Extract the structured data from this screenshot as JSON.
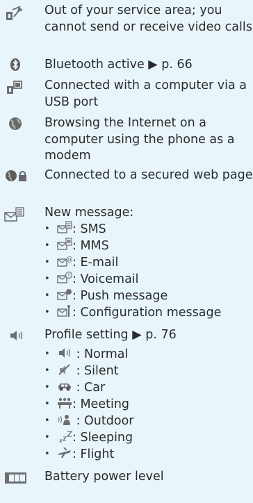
{
  "rows": [
    {
      "icon": "no-service-icon",
      "text": "Out of your service area; you cannot send or receive video calls"
    },
    {
      "icon": "bluetooth-icon",
      "text": "Bluetooth active ▶ p. 66"
    },
    {
      "icon": "usb-connection-icon",
      "text": "Connected with a computer via a USB port"
    },
    {
      "icon": "globe-icon",
      "text": "Browsing the Internet on a computer using the phone as a modem"
    },
    {
      "icon": "secured-web-icon",
      "text": "Connected to a secured web page"
    },
    {
      "icon": "new-message-icon",
      "text": "New message:"
    },
    {
      "icon": "speaker-icon",
      "text": "Profile setting ▶ p. 76"
    },
    {
      "icon": "battery-icon",
      "text": "Battery power level"
    }
  ],
  "message_types": [
    {
      "icon": "sms-icon",
      "label": ": SMS"
    },
    {
      "icon": "mms-icon",
      "label": ": MMS"
    },
    {
      "icon": "email-icon",
      "label": ": E-mail"
    },
    {
      "icon": "voicemail-icon",
      "label": ": Voicemail"
    },
    {
      "icon": "push-message-icon",
      "label": ": Push message"
    },
    {
      "icon": "configuration-message-icon",
      "label": ": Configuration message"
    }
  ],
  "profiles": [
    {
      "icon": "normal-profile-icon",
      "label": " : Normal"
    },
    {
      "icon": "silent-profile-icon",
      "label": " : Silent"
    },
    {
      "icon": "car-profile-icon",
      "label": " : Car"
    },
    {
      "icon": "meeting-profile-icon",
      "label": ": Meeting"
    },
    {
      "icon": "outdoor-profile-icon",
      "label": " : Outdoor"
    },
    {
      "icon": "sleeping-profile-icon",
      "label": ": Sleeping"
    },
    {
      "icon": "flight-profile-icon",
      "label": ": Flight"
    }
  ],
  "bullet_glyph": "•",
  "colors": {
    "background": "#e8f6fb",
    "text": "#2b2b2b",
    "icon_gray": "#6f6f6f"
  }
}
